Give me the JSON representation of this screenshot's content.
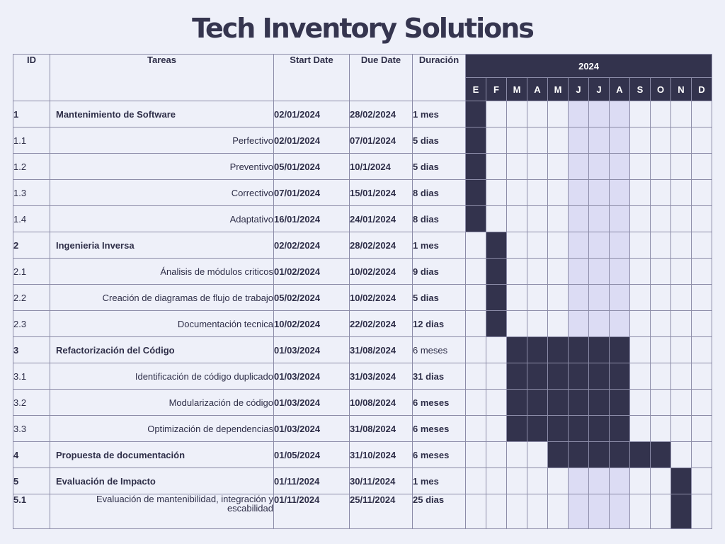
{
  "title": "Tech Inventory Solutions",
  "headers": {
    "id": "ID",
    "task": "Tareas",
    "start": "Start Date",
    "due": "Due Date",
    "duration": "Duración",
    "year": "2024"
  },
  "months": [
    "E",
    "F",
    "M",
    "A",
    "M",
    "J",
    "J",
    "A",
    "S",
    "O",
    "N",
    "D"
  ],
  "highlight_months": [
    5,
    6,
    7
  ],
  "colors": {
    "bar": "#33334d",
    "background": "#eef0f9",
    "highlight": "#dcdcf4",
    "grid": "#8c8ca8"
  },
  "rows": [
    {
      "id": "1",
      "task": "Mantenimiento de Software",
      "start": "02/01/2024",
      "due": "28/02/2024",
      "duration": "1 mes",
      "main": true,
      "span": [
        0,
        0
      ]
    },
    {
      "id": "1.1",
      "task": "Perfectivo",
      "start": "02/01/2024",
      "due": "07/01/2024",
      "duration": "5 dias",
      "main": false,
      "span": [
        0,
        0
      ]
    },
    {
      "id": "1.2",
      "task": "Preventivo",
      "start": "05/01/2024",
      "due": "10/1/2024",
      "duration": "5 dias",
      "main": false,
      "span": [
        0,
        0
      ]
    },
    {
      "id": "1.3",
      "task": "Correctivo",
      "start": "07/01/2024",
      "due": "15/01/2024",
      "duration": "8 dias",
      "main": false,
      "span": [
        0,
        0
      ]
    },
    {
      "id": "1.4",
      "task": "Adaptativo",
      "start": "16/01/2024",
      "due": "24/01/2024",
      "duration": "8 dias",
      "main": false,
      "span": [
        0,
        0
      ]
    },
    {
      "id": "2",
      "task": "Ingenieria Inversa",
      "start": "02/02/2024",
      "due": "28/02/2024",
      "duration": "1 mes",
      "main": true,
      "span": [
        1,
        1
      ]
    },
    {
      "id": "2.1",
      "task": "Ánalisis de módulos criticos",
      "start": "01/02/2024",
      "due": "10/02/2024",
      "duration": "9 dias",
      "main": false,
      "span": [
        1,
        1
      ]
    },
    {
      "id": "2.2",
      "task": "Creación de diagramas de flujo de trabajo",
      "start": "05/02/2024",
      "due": "10/02/2024",
      "duration": "5 dias",
      "main": false,
      "span": [
        1,
        1
      ]
    },
    {
      "id": "2.3",
      "task": "Documentación tecnica",
      "start": "10/02/2024",
      "due": "22/02/2024",
      "duration": "12 dias",
      "main": false,
      "span": [
        1,
        1
      ]
    },
    {
      "id": "3",
      "task": "Refactorización del Código",
      "start": "01/03/2024",
      "due": "31/08/2024",
      "duration": "6 meses",
      "main": true,
      "span": [
        2,
        7
      ],
      "light_duration": true
    },
    {
      "id": "3.1",
      "task": "Identificación de código duplicado",
      "start": "01/03/2024",
      "due": "31/03/2024",
      "duration": "31 dias",
      "main": false,
      "span": [
        2,
        7
      ]
    },
    {
      "id": "3.2",
      "task": "Modularización de código",
      "start": "01/03/2024",
      "due": "10/08/2024",
      "duration": "6 meses",
      "main": false,
      "span": [
        2,
        7
      ]
    },
    {
      "id": "3.3",
      "task": "Optimización de dependencias",
      "start": "01/03/2024",
      "due": "31/08/2024",
      "duration": "6 meses",
      "main": false,
      "span": [
        2,
        7
      ]
    },
    {
      "id": "4",
      "task": "Propuesta de documentación",
      "start": "01/05/2024",
      "due": "31/10/2024",
      "duration": "6 meses",
      "main": true,
      "span": [
        4,
        9
      ]
    },
    {
      "id": "5",
      "task": "Evaluación de Impacto",
      "start": "01/11/2024",
      "due": "30/11/2024",
      "duration": "1 mes",
      "main": true,
      "span": [
        10,
        10
      ]
    },
    {
      "id": "5.1",
      "task": "Evaluación de mantenibilidad, integración y escabilidad",
      "start": "01/11/2024",
      "due": "25/11/2024",
      "duration": "25 dias",
      "main": false,
      "span": [
        10,
        10
      ],
      "bold_id": true,
      "tall": true
    }
  ]
}
